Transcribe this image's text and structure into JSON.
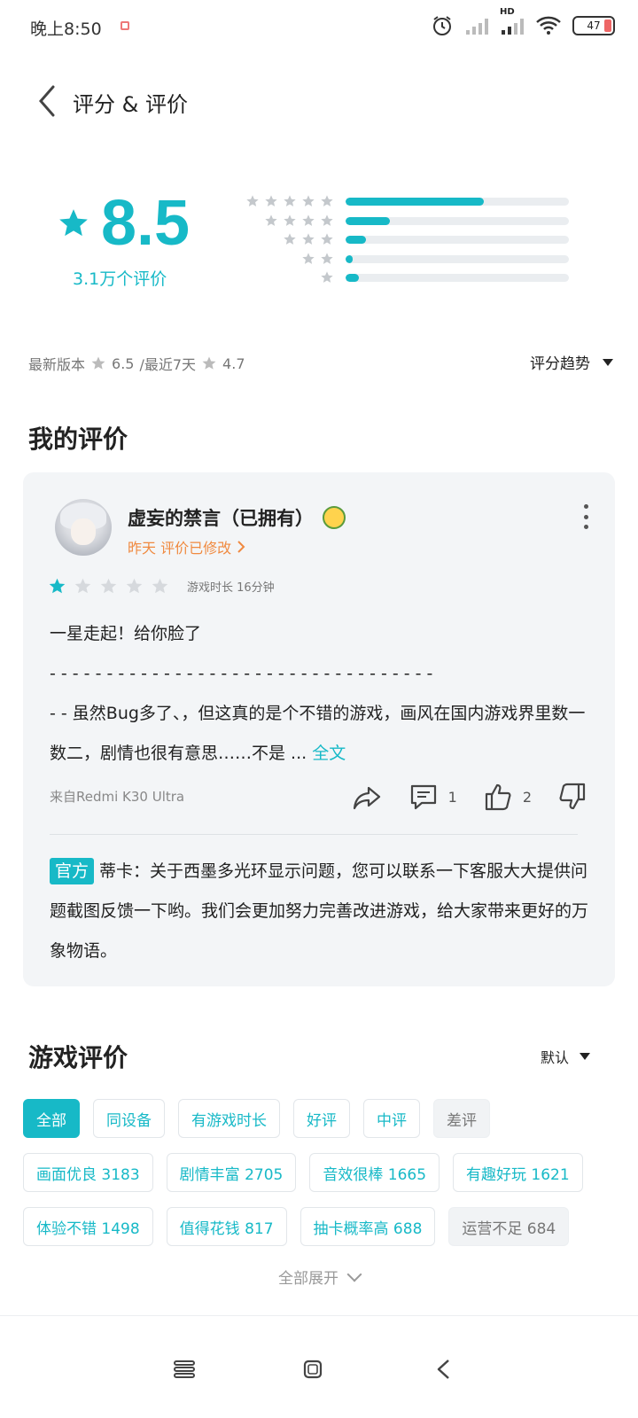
{
  "status_bar": {
    "time": "晚上8:50",
    "battery": "47",
    "network_label": "HD"
  },
  "header": {
    "title": "评分 & 评价"
  },
  "rating": {
    "score": "8.5",
    "count_label": "3.1万个评价",
    "distribution": [
      {
        "stars": 5,
        "fraction": 0.62
      },
      {
        "stars": 4,
        "fraction": 0.2
      },
      {
        "stars": 3,
        "fraction": 0.09
      },
      {
        "stars": 2,
        "fraction": 0.03
      },
      {
        "stars": 1,
        "fraction": 0.06
      }
    ]
  },
  "version_line": {
    "latest_label": "最新版本",
    "latest_score": "6.5",
    "recent_label": "/最近7天",
    "recent_score": "4.7",
    "trend_label": "评分趋势"
  },
  "my_review": {
    "section_title": "我的评价",
    "username": "虚妄的禁言（已拥有）",
    "meta": "昨天 评价已修改",
    "stars": 1,
    "playtime": "游戏时长 16分钟",
    "text_line1": "一星走起！给你脸了",
    "text_line2": "- - - - - - - - - - - - - - - - - - - - - - - - - - - - - - - - - -",
    "text_line3": "- - 虽然Bug多了、，但这真的是个不错的游戏，画风在国内游戏界里数一数二，剧情也很有意思……不是 ... ",
    "full_text_link": "全文",
    "device": "来自Redmi K30 Ultra",
    "comment_count": "1",
    "like_count": "2",
    "official_tag": "官方",
    "official_reply": "蒂卡：关于西墨多光环显示问题，您可以联系一下客服大大提供问题截图反馈一下哟。我们会更加努力完善改进游戏，给大家带来更好的万象物语。"
  },
  "game_reviews": {
    "section_title": "游戏评价",
    "sort_label": "默认",
    "filters_row1": [
      "全部",
      "同设备",
      "有游戏时长",
      "好评",
      "中评",
      "差评"
    ],
    "filters_row2": [
      "画面优良 3183",
      "剧情丰富 2705",
      "音效很棒 1665",
      "有趣好玩 1621"
    ],
    "filters_row3": [
      "体验不错 1498",
      "值得花钱 817",
      "抽卡概率高 688",
      "运营不足 684"
    ],
    "expand_label": "全部展开"
  },
  "colors": {
    "accent": "#17b9c7",
    "meta_orange": "#f08a40"
  }
}
